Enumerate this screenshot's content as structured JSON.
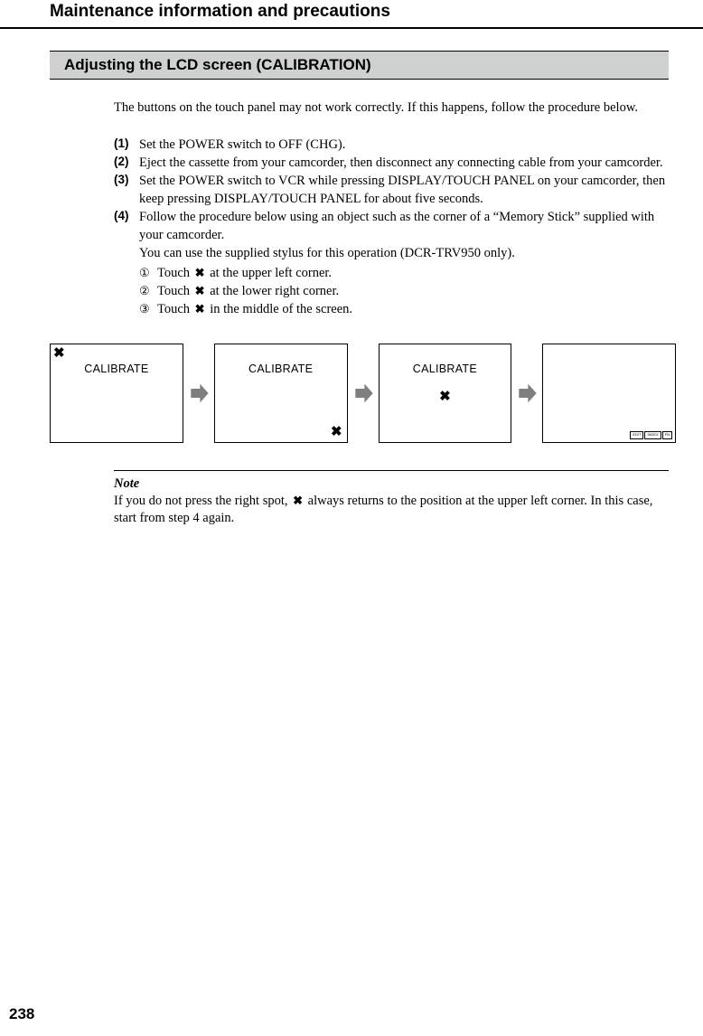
{
  "header": "Maintenance information and precautions",
  "section": "Adjusting the LCD screen (CALIBRATION)",
  "intro": "The buttons on the touch panel may not work correctly. If this happens, follow the procedure below.",
  "steps": [
    {
      "num": "(1)",
      "text": "Set the POWER switch to OFF (CHG)."
    },
    {
      "num": "(2)",
      "text": "Eject the cassette from your camcorder, then disconnect any connecting cable from your camcorder."
    },
    {
      "num": "(3)",
      "text": "Set the POWER switch to VCR while pressing DISPLAY/TOUCH PANEL on your camcorder, then keep pressing DISPLAY/TOUCH PANEL for about five seconds."
    },
    {
      "num": "(4)",
      "text": "Follow the procedure below using an object such as the corner of a “Memory Stick” supplied with your camcorder.",
      "extraLine": "You can use the supplied stylus for this operation (DCR-TRV950 only).",
      "subs": [
        {
          "circ": "①",
          "pre": "Touch ",
          "post": " at the upper left corner."
        },
        {
          "circ": "②",
          "pre": "Touch ",
          "post": " at the lower right corner."
        },
        {
          "circ": "③",
          "pre": "Touch ",
          "post": " in the middle of the screen."
        }
      ]
    }
  ],
  "screens": [
    {
      "label": "CALIBRATE",
      "xpos": "tl"
    },
    {
      "label": "CALIBRATE",
      "xpos": "br"
    },
    {
      "label": "CALIBRATE",
      "xpos": "mid"
    },
    {
      "label": "",
      "xpos": "final",
      "buttons": [
        "EDIT",
        "INDEX",
        "FN"
      ]
    }
  ],
  "note": {
    "label": "Note",
    "pre": "If you do not press the right spot, ",
    "post": " always returns to the position at the upper left corner. In this case, start from step 4 again."
  },
  "pageNumber": "238",
  "xglyph": "✖"
}
